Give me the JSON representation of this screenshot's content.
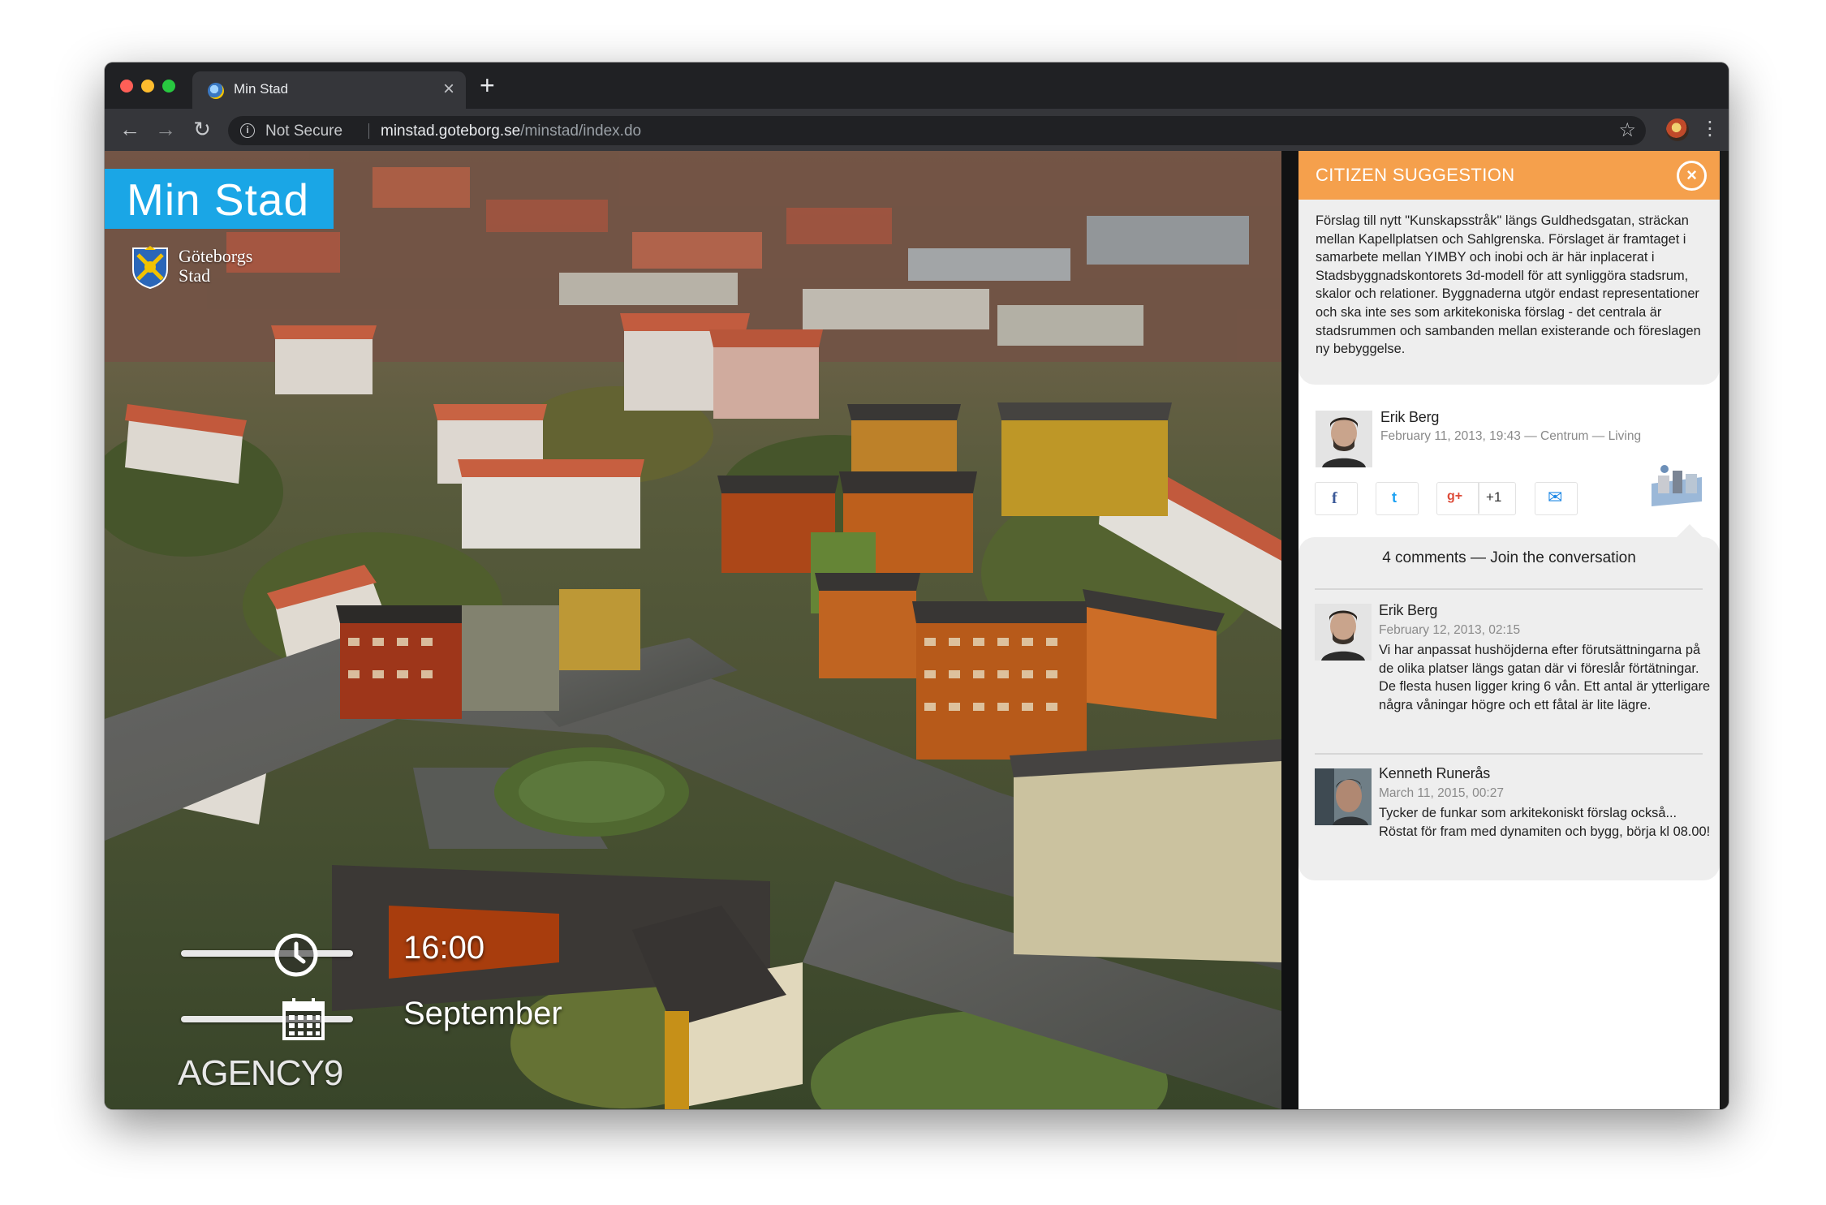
{
  "browser": {
    "tab_title": "Min Stad",
    "security_label": "Not Secure",
    "url_host": "minstad.goteborg.se",
    "url_path": "/minstad/index.do"
  },
  "map": {
    "brand_title": "Min Stad",
    "city_name": "Göteborgs\nStad",
    "time_label": "16:00",
    "month_label": "September",
    "credit": "AGENCY9"
  },
  "panel": {
    "title": "CITIZEN SUGGESTION",
    "accent_color": "#f5a04c",
    "brand_color": "#1aa6e6",
    "suggestion_text": "Förslag till nytt \"Kunskapsstråk\" längs Guldhedsgatan, sträckan mellan Kapellplatsen och Sahlgrenska. Förslaget är framtaget i samarbete mellan YIMBY och inobi och är här inplacerat i Stadsbyggnadskontorets 3d-modell för att synliggöra stadsrum, skalor och relationer. Byggnaderna utgör endast representationer och ska inte ses som arkitekoniska förslag - det centrala är stadsrummen och sambanden mellan existerande och föreslagen ny bebyggelse.",
    "author": {
      "name": "Erik Berg",
      "meta": "February 11, 2013, 19:43 — Centrum — Living"
    },
    "share": {
      "facebook": "f",
      "twitter": "t",
      "googleplus": "g+",
      "plusone": "+1",
      "email": "✉"
    },
    "comments_header": "4 comments — Join the conversation",
    "comments": [
      {
        "name": "Erik Berg",
        "date": "February 12, 2013, 02:15",
        "text": "Vi har anpassat hushöjderna efter förutsättningarna på de olika platser längs gatan där vi föreslår förtätningar. De flesta husen ligger kring 6 vån. Ett antal är ytterligare några våningar högre och ett fåtal är lite lägre."
      },
      {
        "name": "Kenneth Runerås",
        "date": "March 11, 2015, 00:27",
        "text": "Tycker de funkar som arkitekoniskt förslag också... Röstat för fram med dynamiten och bygg, börja kl 08.00!"
      }
    ]
  }
}
